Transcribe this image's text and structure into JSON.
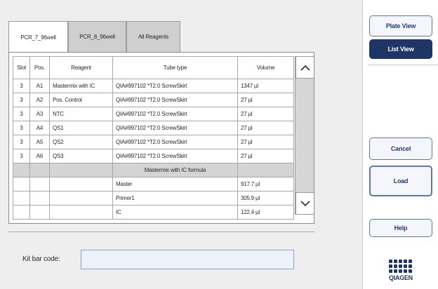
{
  "tabs": [
    {
      "label": "PCR_7_96well",
      "active": true
    },
    {
      "label": "PCR_8_96well",
      "active": false
    },
    {
      "label": "All Reagents",
      "active": false
    }
  ],
  "table": {
    "headers": {
      "slot": "Slot",
      "pos": "Pos.",
      "reagent": "Reagent",
      "tube_type": "Tube type",
      "volume": "Volume"
    },
    "rows": [
      {
        "slot": "3",
        "pos": "A1",
        "reagent": "Mastermix with IC",
        "tube_type": "QIA#997102 *T2.0 ScrewSkirt",
        "volume": "1347 µl"
      },
      {
        "slot": "3",
        "pos": "A2",
        "reagent": "Pos. Control",
        "tube_type": "QIA#997102 *T2.0 ScrewSkirt",
        "volume": "27 µl"
      },
      {
        "slot": "3",
        "pos": "A3",
        "reagent": "NTC",
        "tube_type": "QIA#997102 *T2.0 ScrewSkirt",
        "volume": "27 µl"
      },
      {
        "slot": "3",
        "pos": "A4",
        "reagent": "QS1",
        "tube_type": "QIA#997102 *T2.0 ScrewSkirt",
        "volume": "27 µl"
      },
      {
        "slot": "3",
        "pos": "A5",
        "reagent": "QS2",
        "tube_type": "QIA#997102 *T2.0 ScrewSkirt",
        "volume": "27 µl"
      },
      {
        "slot": "3",
        "pos": "A6",
        "reagent": "QS3",
        "tube_type": "QIA#997102 *T2.0 ScrewSkirt",
        "volume": "27 µl"
      }
    ],
    "section_label": "Mastermix with IC formula",
    "formula_rows": [
      {
        "component": "Master",
        "volume": "917.7 µl"
      },
      {
        "component": "Primer1",
        "volume": "305.9 µl"
      },
      {
        "component": "IC",
        "volume": "122.4 µl"
      }
    ]
  },
  "kit": {
    "label": "Kit bar code:",
    "value": ""
  },
  "side_buttons": {
    "plate_view": "Plate View",
    "list_view": "List View",
    "cancel": "Cancel",
    "load": "Load",
    "help": "Help"
  },
  "logo": {
    "text": "QIAGEN"
  },
  "icons": {
    "scroll_up": "chevron-up-icon",
    "scroll_down": "chevron-down-icon",
    "logo": "qiagen-logo-icon"
  },
  "colors": {
    "brand": "#1e3566",
    "panel_bg": "#eeeeee",
    "input_bg": "#eef3fb"
  }
}
